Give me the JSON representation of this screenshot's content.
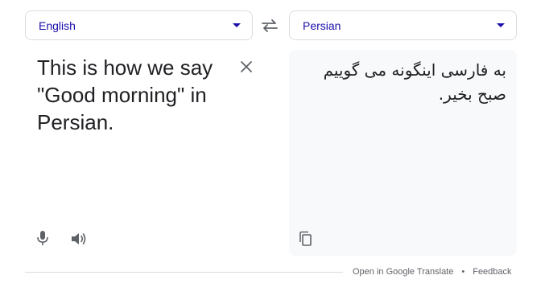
{
  "source_language": {
    "label": "English"
  },
  "target_language": {
    "label": "Persian"
  },
  "source": {
    "text": "This is how we say \"Good morning\" in Persian."
  },
  "translation": {
    "text": "به فارسی اینگونه می گوییم صبح بخیر."
  },
  "footer": {
    "open_link": "Open in Google Translate",
    "separator": "•",
    "feedback_link": "Feedback"
  },
  "colors": {
    "accent": "#1a0dab",
    "border": "#dadce0",
    "icon": "#5f6368",
    "text": "#202124",
    "target_bg": "#f8f9fa"
  },
  "icons": [
    "chevron-down-icon",
    "swap-icon",
    "close-icon",
    "microphone-icon",
    "speaker-icon",
    "copy-icon"
  ]
}
